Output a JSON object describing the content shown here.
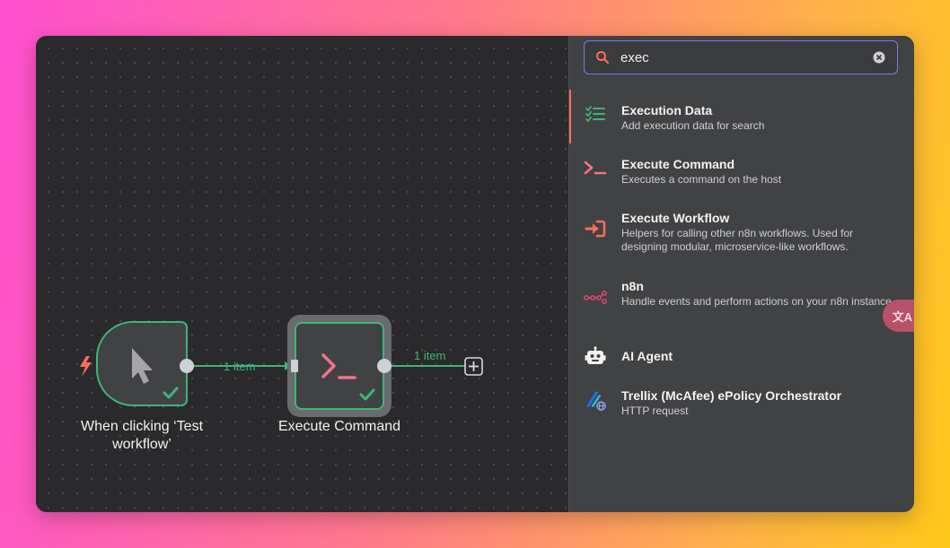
{
  "canvas": {
    "nodes": [
      {
        "label": "When clicking ‘Test workflow’",
        "icon": "pointer-icon"
      },
      {
        "label": "Execute Command",
        "icon": "terminal-icon"
      }
    ],
    "connections": [
      {
        "label": "1 item"
      },
      {
        "label": "1 item"
      }
    ]
  },
  "search": {
    "value": "exec",
    "placeholder": ""
  },
  "results": [
    {
      "title": "Execution Data",
      "desc": "Add execution data for search",
      "icon": "checklist-icon"
    },
    {
      "title": "Execute Command",
      "desc": "Executes a command on the host",
      "icon": "terminal-icon"
    },
    {
      "title": "Execute Workflow",
      "desc": "Helpers for calling other n8n workflows. Used for designing modular, microservice-like workflows.",
      "icon": "sign-in-icon"
    },
    {
      "title": "n8n",
      "desc": "Handle events and perform actions on your n8n instance",
      "icon": "n8n-logo-icon"
    },
    {
      "title": "AI Agent",
      "desc": "",
      "icon": "robot-icon"
    },
    {
      "title": "Trellix (McAfee) ePolicy Orchestrator",
      "desc": "HTTP request",
      "icon": "trellix-icon"
    }
  ],
  "translate_button": {
    "label": "文A"
  },
  "colors": {
    "accent": "#ff6d5a",
    "success": "#3fb47a",
    "focus": "#8178e8",
    "terminal": "#f0738a"
  }
}
